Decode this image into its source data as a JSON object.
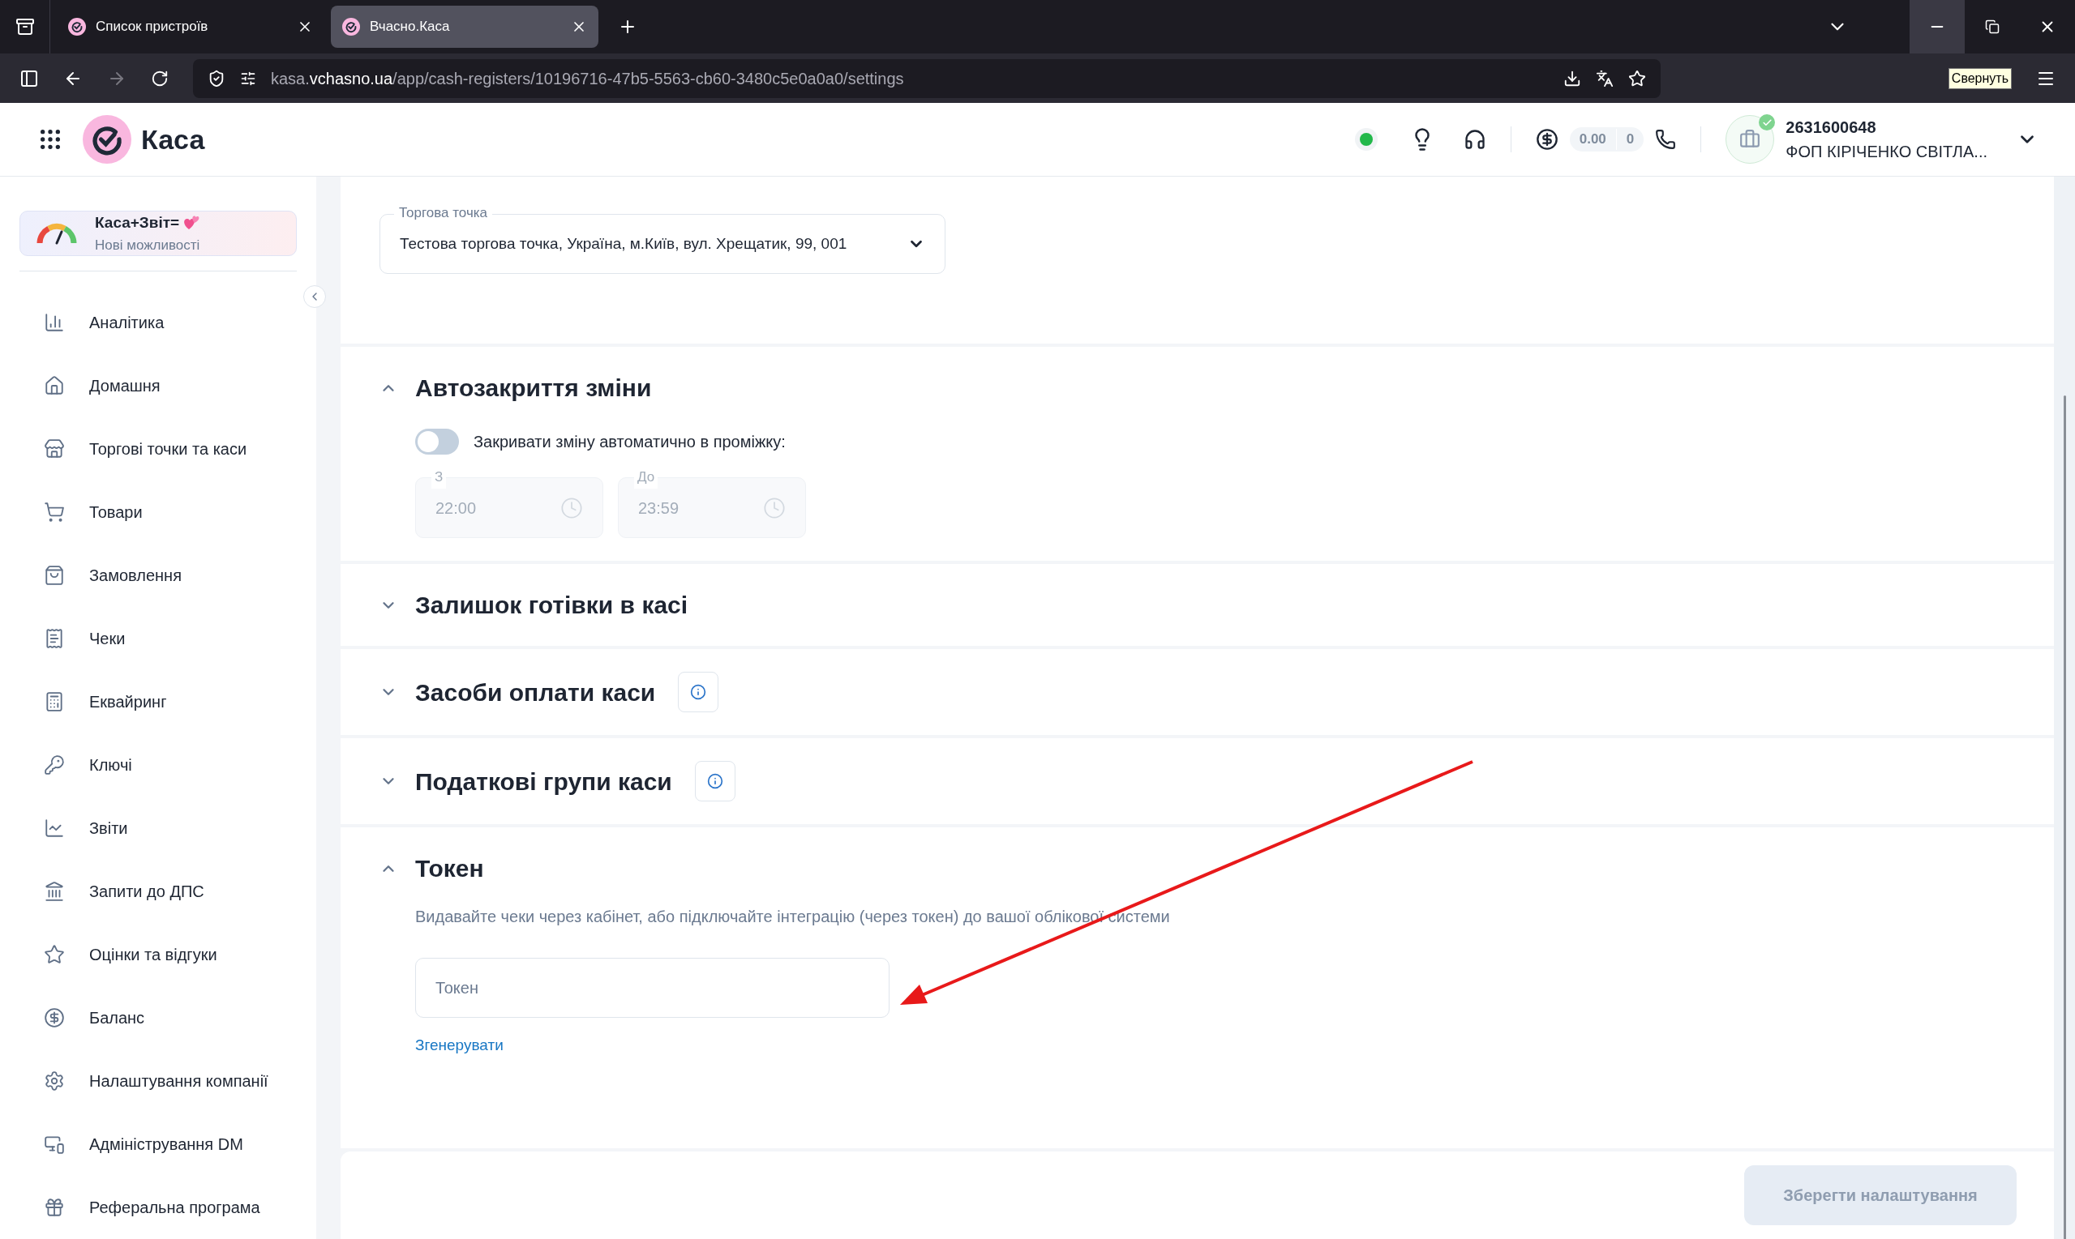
{
  "browser": {
    "tabs": [
      {
        "title": "Список пристроїв",
        "selected": false
      },
      {
        "title": "Вчасно.Каса",
        "selected": true
      }
    ],
    "url": {
      "host": "kasa.",
      "domain": "vchasno.ua",
      "path": "/app/cash-registers/10196716-47b5-5563-cb60-3480c5e0a0a0/settings"
    },
    "tooltip": "Свернуть"
  },
  "header": {
    "app_name": "Каса",
    "balance": "0.00",
    "count": "0",
    "company_id": "2631600648",
    "company_name": "ФОП КІРІЧЕНКО СВІТЛА..."
  },
  "promo": {
    "title": "Каса+Звіт=",
    "subtitle": "Нові можливості"
  },
  "sidebar": {
    "items": [
      "Аналітика",
      "Домашня",
      "Торгові точки та каси",
      "Товари",
      "Замовлення",
      "Чеки",
      "Еквайринг",
      "Ключі",
      "Звіти",
      "Запити до ДПС",
      "Оцінки та відгуки",
      "Баланс",
      "Налаштування компанії",
      "Адміністрування DM",
      "Реферальна програма"
    ]
  },
  "store_select": {
    "label": "Торгова точка",
    "value": "Тестова торгова точка, Україна, м.Київ, вул. Хрещатик, 99, 001"
  },
  "sections": [
    {
      "kind": "autoclose",
      "title": "Автозакриття зміни",
      "expanded": true,
      "info": false,
      "toggle": {
        "label": "Закривати зміну автоматично в проміжку:",
        "on": false
      },
      "fields": [
        {
          "label": "З",
          "value": "22:00",
          "disabled": true
        },
        {
          "label": "До",
          "value": "23:59",
          "disabled": true
        }
      ]
    },
    {
      "kind": "plain",
      "title": "Залишок готівки в касі",
      "expanded": false,
      "info": false
    },
    {
      "kind": "plain",
      "title": "Засоби оплати каси",
      "expanded": false,
      "info": true
    },
    {
      "kind": "plain",
      "title": "Податкові групи каси",
      "expanded": false,
      "info": true
    },
    {
      "kind": "token",
      "title": "Токен",
      "expanded": true,
      "info": false,
      "description": "Видавайте чеки через кабінет, або підключайте інтеграцію (через токен) до вашої облікової системи",
      "placeholder": "Токен",
      "link": "Згенерувати"
    }
  ],
  "save_button": {
    "label": "Зберегти налаштування",
    "disabled": true
  }
}
